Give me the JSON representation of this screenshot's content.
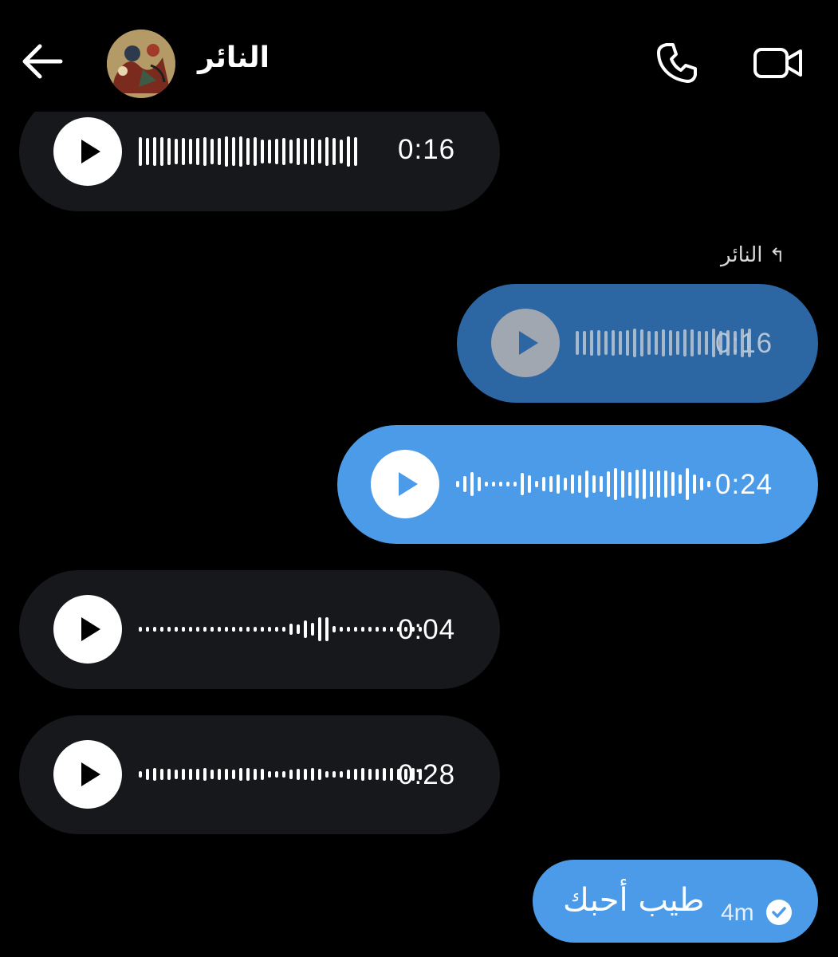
{
  "header": {
    "contact_name": "النائر",
    "icons": {
      "back": "arrow-left-icon",
      "call": "phone-icon",
      "video": "video-camera-icon"
    }
  },
  "messages": [
    {
      "type": "voice",
      "direction": "incoming",
      "duration": "0:16"
    },
    {
      "type": "reply_label",
      "text": "النائر",
      "icon": "reply-arrow-icon"
    },
    {
      "type": "voice",
      "direction": "outgoing",
      "quoted": true,
      "duration": "0:16"
    },
    {
      "type": "voice",
      "direction": "outgoing",
      "duration": "0:24"
    },
    {
      "type": "voice",
      "direction": "incoming",
      "duration": "0:04"
    },
    {
      "type": "voice",
      "direction": "incoming",
      "duration": "0:28"
    },
    {
      "type": "text",
      "direction": "outgoing",
      "text": "طيب أحبك",
      "time": "4m",
      "status_icon": "check-circle-icon"
    }
  ],
  "colors": {
    "background": "#000000",
    "incoming_bubble": "#17181b",
    "outgoing_bubble": "#4c9be8",
    "quoted_bubble": "#2c67a3"
  }
}
